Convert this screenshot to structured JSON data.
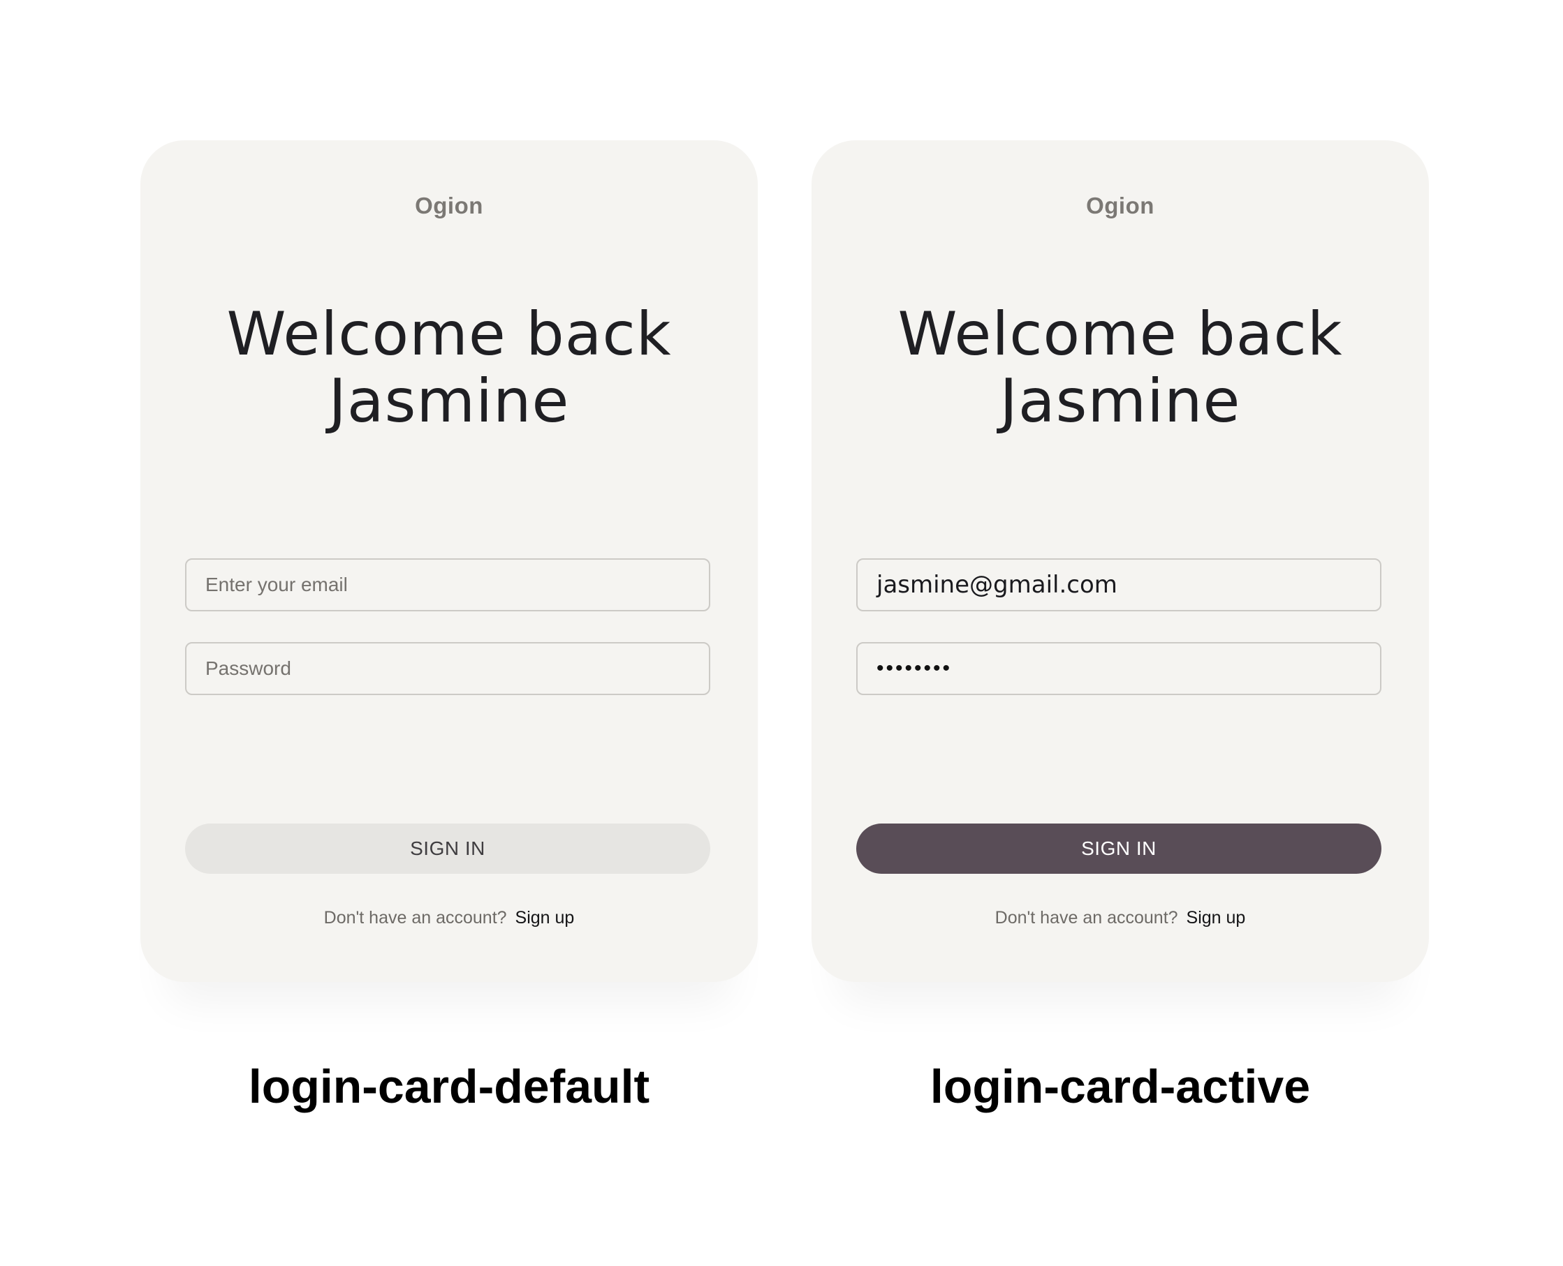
{
  "default_card": {
    "brand": "Ogion",
    "welcome_line1": "Welcome back",
    "welcome_line2": "Jasmine",
    "email_placeholder": "Enter your email",
    "password_placeholder": "Password",
    "signin_label": "SIGN IN",
    "footer_question": "Don't have an account?",
    "footer_link": "Sign up",
    "caption": "login-card-default"
  },
  "active_card": {
    "brand": "Ogion",
    "welcome_line1": "Welcome back",
    "welcome_line2": "Jasmine",
    "email_value": "jasmine@gmail.com",
    "password_mask": "••••••••",
    "signin_label": "SIGN IN",
    "footer_question": "Don't have an account?",
    "footer_link": "Sign up",
    "caption": "login-card-active"
  },
  "colors": {
    "card_background": "#f5f4f1",
    "button_disabled": "#e6e5e2",
    "button_active": "#594d57"
  }
}
